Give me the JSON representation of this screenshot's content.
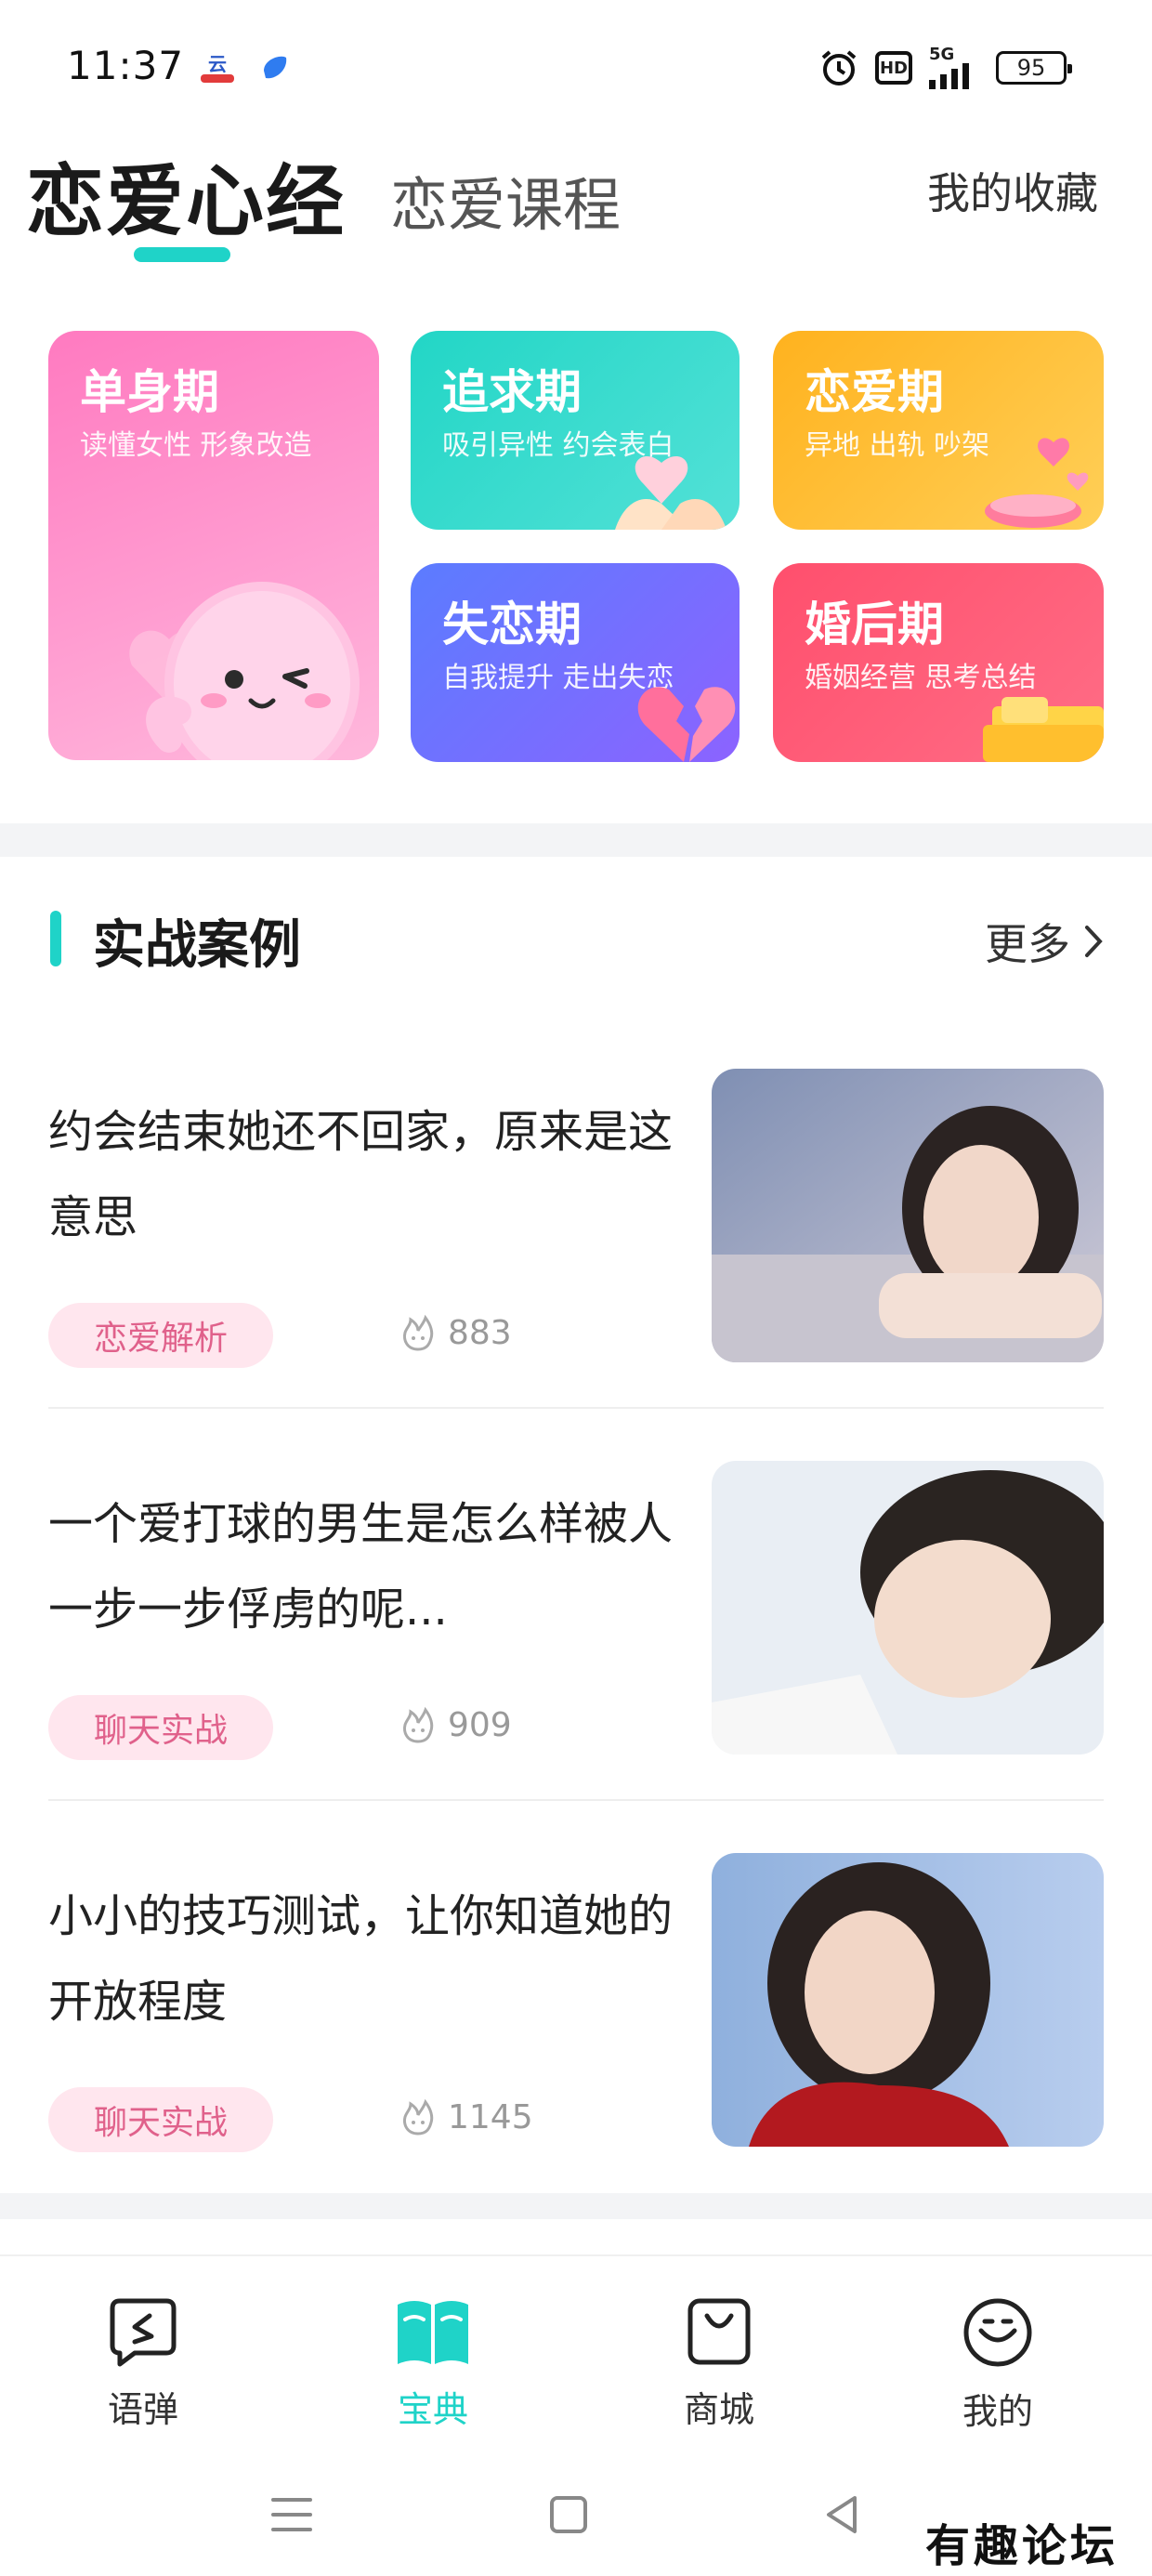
{
  "status_bar": {
    "time": "11:37",
    "hd": "HD",
    "network": "5G",
    "battery": "95",
    "icons": [
      "app-notification-icon",
      "app-notification-icon-2",
      "alarm-icon",
      "hd-icon",
      "signal-icon",
      "battery-icon"
    ]
  },
  "header": {
    "active_tab": "恋爱心经",
    "inactive_tab": "恋爱课程",
    "favorites": "我的收藏"
  },
  "categories": [
    {
      "title": "单身期",
      "subtitle": "读懂女性 形象改造",
      "color": "#ff86c4"
    },
    {
      "title": "追求期",
      "subtitle": "吸引异性 约会表白",
      "color": "#2fd8c9"
    },
    {
      "title": "恋爱期",
      "subtitle": "异地 出轨 吵架",
      "color": "#ffbd33"
    },
    {
      "title": "失恋期",
      "subtitle": "自我提升 走出失恋",
      "color": "#6a70ff"
    },
    {
      "title": "婚后期",
      "subtitle": "婚姻经营 思考总结",
      "color": "#ff5b77"
    }
  ],
  "section": {
    "title": "实战案例",
    "more": "更多"
  },
  "articles": [
    {
      "title": "约会结束她还不回家，原来是这意思",
      "tag": "恋爱解析",
      "views": "883"
    },
    {
      "title": "一个爱打球的男生是怎么样被人一步一步俘虏的呢...",
      "tag": "聊天实战",
      "views": "909"
    },
    {
      "title": "小小的技巧测试，让你知道她的开放程度",
      "tag": "聊天实战",
      "views": "1145"
    }
  ],
  "bottom_nav": {
    "items": [
      {
        "label": "语弹",
        "icon": "chat-bubble-icon"
      },
      {
        "label": "宝典",
        "icon": "open-book-icon",
        "active": true
      },
      {
        "label": "商城",
        "icon": "shopping-bag-icon"
      },
      {
        "label": "我的",
        "icon": "smile-face-icon"
      }
    ],
    "accent": "#1fd3c8"
  },
  "watermark": "有趣论坛"
}
